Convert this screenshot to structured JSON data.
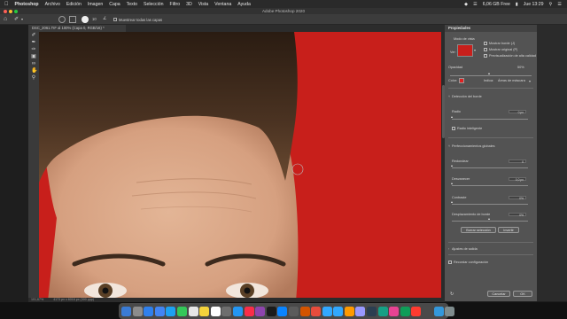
{
  "menubar": {
    "apple": "",
    "app": "Photoshop",
    "items": [
      "Archivo",
      "Edición",
      "Imagen",
      "Capa",
      "Texto",
      "Selección",
      "Filtro",
      "3D",
      "Vista",
      "Ventana",
      "Ayuda"
    ],
    "battery": "6,06 GB Free",
    "datetime": "Jue 13:29"
  },
  "window": {
    "title": "Adobe Photoshop 2020"
  },
  "options_bar": {
    "size_value": "10",
    "sample_label": "Muestrear todas las capas"
  },
  "document_tab": {
    "label": "DSC_2061.TIF al 100% (Capa 0, RGB/16) *"
  },
  "status": {
    "zoom": "101,67%",
    "info": "4173 px x 6016 px (300 ppp)"
  },
  "panel": {
    "title": "Propiedades",
    "view_mode_label": "Modo de vista",
    "view_label": "Ver:",
    "show_edges": "Mostrar borde (J)",
    "show_original": "Mostrar original (P)",
    "hq_preview": "Previsualización de alta calidad",
    "opacity_label": "Opacidad",
    "opacity_value": "50%",
    "color_label": "Color:",
    "indicates_label": "Indica:",
    "indicates_value": "Áreas de máscara",
    "edge_detection": "Detección del borde",
    "radius_label": "Radio",
    "radius_value": "0 px",
    "smart_radius": "Radio inteligente",
    "global_refine": "Perfeccionamientos globales",
    "smooth_label": "Redondear",
    "smooth_value": "0",
    "feather_label": "Desvanecer",
    "feather_value": "0,0 px",
    "contrast_label": "Contraste",
    "contrast_value": "0%",
    "shift_edge_label": "Desplazamiento de borde",
    "shift_edge_value": "0%",
    "clear_selection": "Borrar selección",
    "invert": "Invertir",
    "output_settings": "Ajustes de salida",
    "remember_settings": "Recordar configuración",
    "cancel": "Cancelar",
    "ok": "OK"
  },
  "colors": {
    "canvas_background": "#c81f1b",
    "mask_color": "#e02020",
    "panel_bg": "#535353"
  }
}
